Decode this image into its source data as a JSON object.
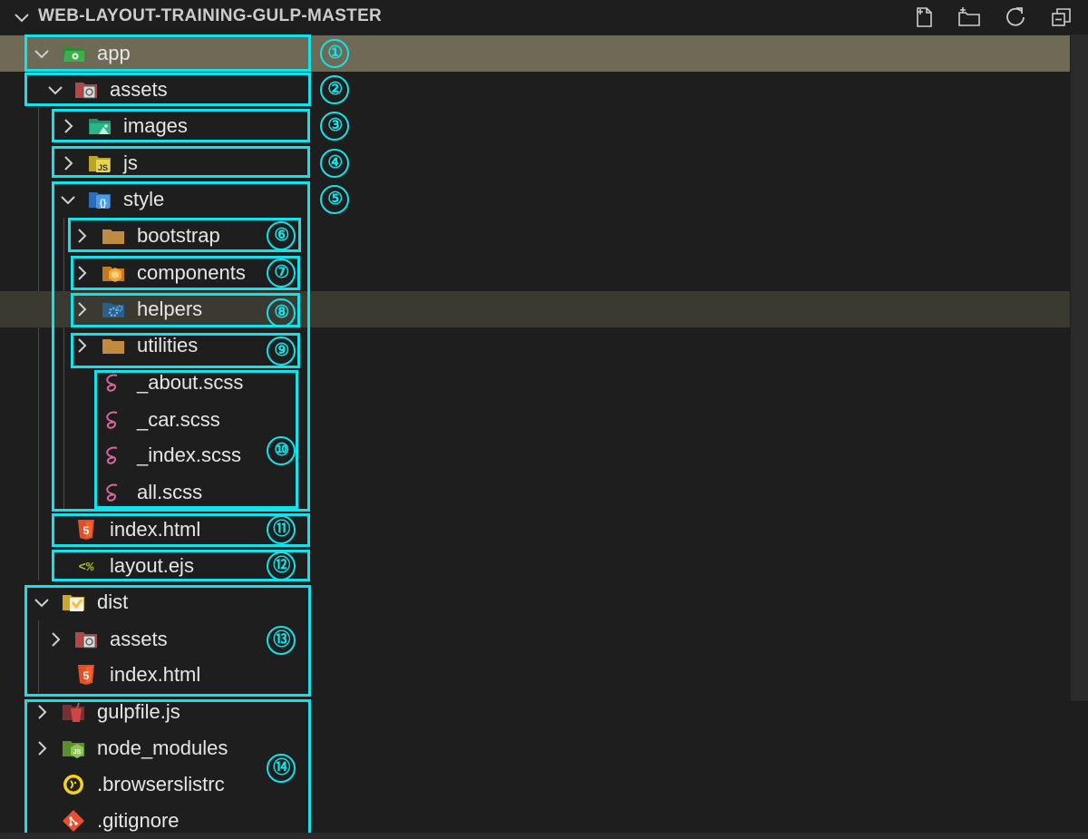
{
  "explorer": {
    "title": "WEB-LAYOUT-TRAINING-GULP-MASTER",
    "toolbar": [
      "new-file-icon",
      "new-folder-icon",
      "refresh-icon",
      "collapse-all-icon"
    ]
  },
  "tree": [
    {
      "label": "app",
      "type": "folder",
      "expanded": true,
      "icon": "app-folder-icon"
    },
    {
      "label": "assets",
      "type": "folder",
      "expanded": true,
      "icon": "assets-folder-icon"
    },
    {
      "label": "images",
      "type": "folder",
      "expanded": false,
      "icon": "images-folder-icon"
    },
    {
      "label": "js",
      "type": "folder",
      "expanded": false,
      "icon": "js-folder-icon"
    },
    {
      "label": "style",
      "type": "folder",
      "expanded": true,
      "icon": "style-folder-icon"
    },
    {
      "label": "bootstrap",
      "type": "folder",
      "expanded": false,
      "icon": "folder-icon"
    },
    {
      "label": "components",
      "type": "folder",
      "expanded": false,
      "icon": "components-folder-icon"
    },
    {
      "label": "helpers",
      "type": "folder",
      "expanded": false,
      "icon": "helpers-folder-icon"
    },
    {
      "label": "utilities",
      "type": "folder",
      "expanded": false,
      "icon": "folder-icon"
    },
    {
      "label": "_about.scss",
      "type": "file",
      "icon": "sass-icon"
    },
    {
      "label": "_car.scss",
      "type": "file",
      "icon": "sass-icon"
    },
    {
      "label": "_index.scss",
      "type": "file",
      "icon": "sass-icon"
    },
    {
      "label": "all.scss",
      "type": "file",
      "icon": "sass-icon"
    },
    {
      "label": "index.html",
      "type": "file",
      "icon": "html5-icon"
    },
    {
      "label": "layout.ejs",
      "type": "file",
      "icon": "ejs-icon"
    },
    {
      "label": "dist",
      "type": "folder",
      "expanded": true,
      "icon": "dist-folder-icon"
    },
    {
      "label": "assets",
      "type": "folder",
      "expanded": false,
      "icon": "assets-folder-icon"
    },
    {
      "label": "index.html",
      "type": "file",
      "icon": "html5-icon"
    },
    {
      "label": "gulpfile.js",
      "type": "folder",
      "expanded": false,
      "icon": "gulp-icon"
    },
    {
      "label": "node_modules",
      "type": "folder",
      "expanded": false,
      "icon": "node-folder-icon"
    },
    {
      "label": ".browserslistrc",
      "type": "file",
      "icon": "browserslist-icon"
    },
    {
      "label": ".gitignore",
      "type": "file",
      "icon": "git-icon"
    }
  ],
  "annotations": [
    "①",
    "②",
    "③",
    "④",
    "⑤",
    "⑥",
    "⑦",
    "⑧",
    "⑨",
    "⑩",
    "⑪",
    "⑫",
    "⑬",
    "⑭"
  ],
  "colors": {
    "annotation": "#12e3ea",
    "selected_row": "#6e6a55",
    "hover_row": "#3b3a30",
    "background": "#1e1e1e"
  }
}
